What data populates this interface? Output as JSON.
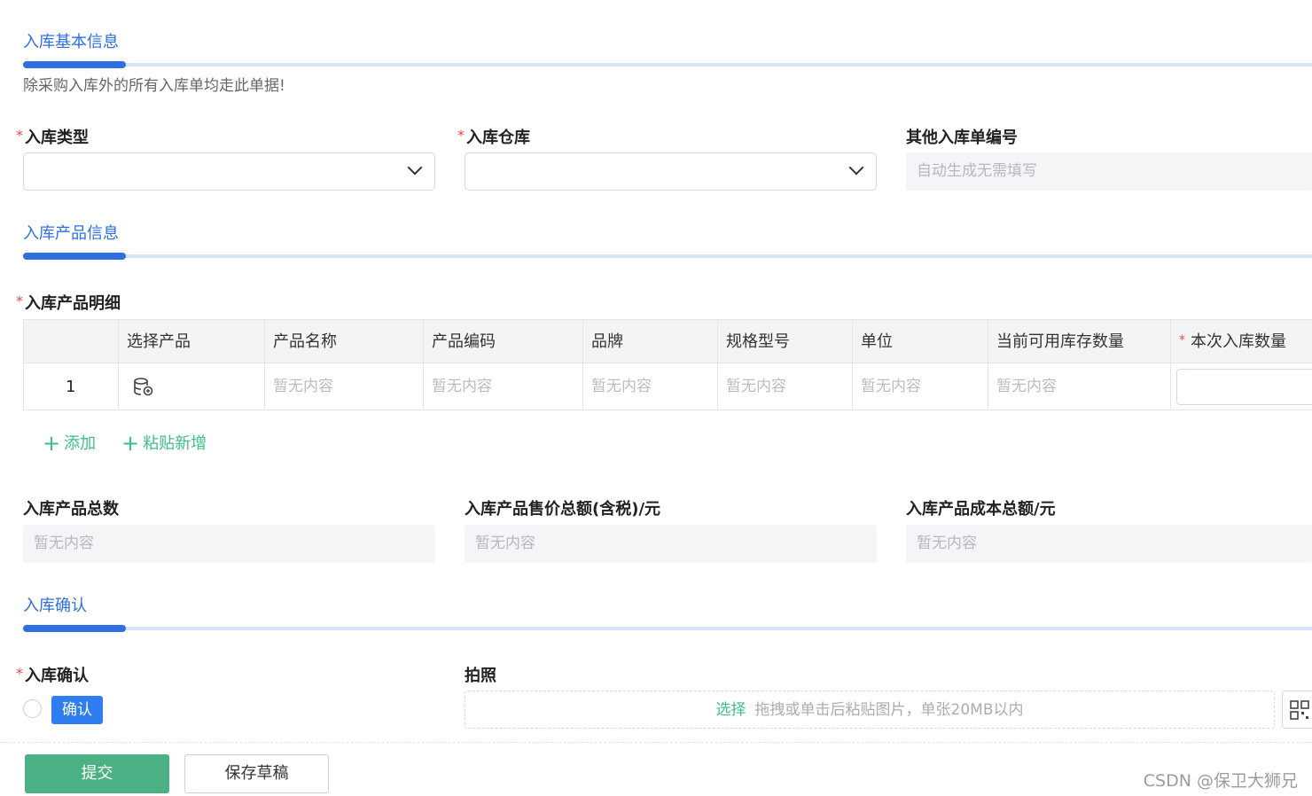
{
  "sections": {
    "basic_info": {
      "title": "入库基本信息",
      "note": "除采购入库外的所有入库单均走此单据!"
    },
    "product_info": {
      "title": "入库产品信息"
    },
    "confirm": {
      "title": "入库确认"
    }
  },
  "fields": {
    "inbound_type": {
      "label": "入库类型",
      "required": "*",
      "value": ""
    },
    "warehouse": {
      "label": "入库仓库",
      "required": "*",
      "value": ""
    },
    "other_number": {
      "label": "其他入库单编号",
      "placeholder": "自动生成无需填写"
    }
  },
  "product_detail": {
    "label": "入库产品明细",
    "required": "*",
    "columns": [
      "",
      "选择产品",
      "产品名称",
      "产品编码",
      "品牌",
      "规格型号",
      "单位",
      "当前可用库存数量",
      "本次入库数量"
    ],
    "qty_required": "*",
    "rows": [
      {
        "index": "1",
        "select_icon": "database-icon",
        "name": "暂无内容",
        "code": "暂无内容",
        "brand": "暂无内容",
        "spec": "暂无内容",
        "unit": "暂无内容",
        "stock": "暂无内容",
        "qty": ""
      }
    ],
    "actions": {
      "add": "添加",
      "paste_add": "粘贴新增"
    }
  },
  "totals": {
    "count": {
      "label": "入库产品总数",
      "value": "暂无内容"
    },
    "price": {
      "label": "入库产品售价总额(含税)/元",
      "value": "暂无内容"
    },
    "cost": {
      "label": "入库产品成本总额/元",
      "value": "暂无内容"
    }
  },
  "confirmation": {
    "label": "入库确认",
    "required": "*",
    "option": "确认",
    "photo_label": "拍照",
    "upload_pick": "选择",
    "upload_hint": "拖拽或单击后粘贴图片，单张20MB以内"
  },
  "footer": {
    "submit": "提交",
    "save_draft": "保存草稿"
  },
  "watermark": "CSDN @保卫大狮兄",
  "colors": {
    "accent": "#2f6fe0",
    "green": "#4bb083",
    "tag_blue": "#2f7df0",
    "required": "#e84a4a"
  }
}
